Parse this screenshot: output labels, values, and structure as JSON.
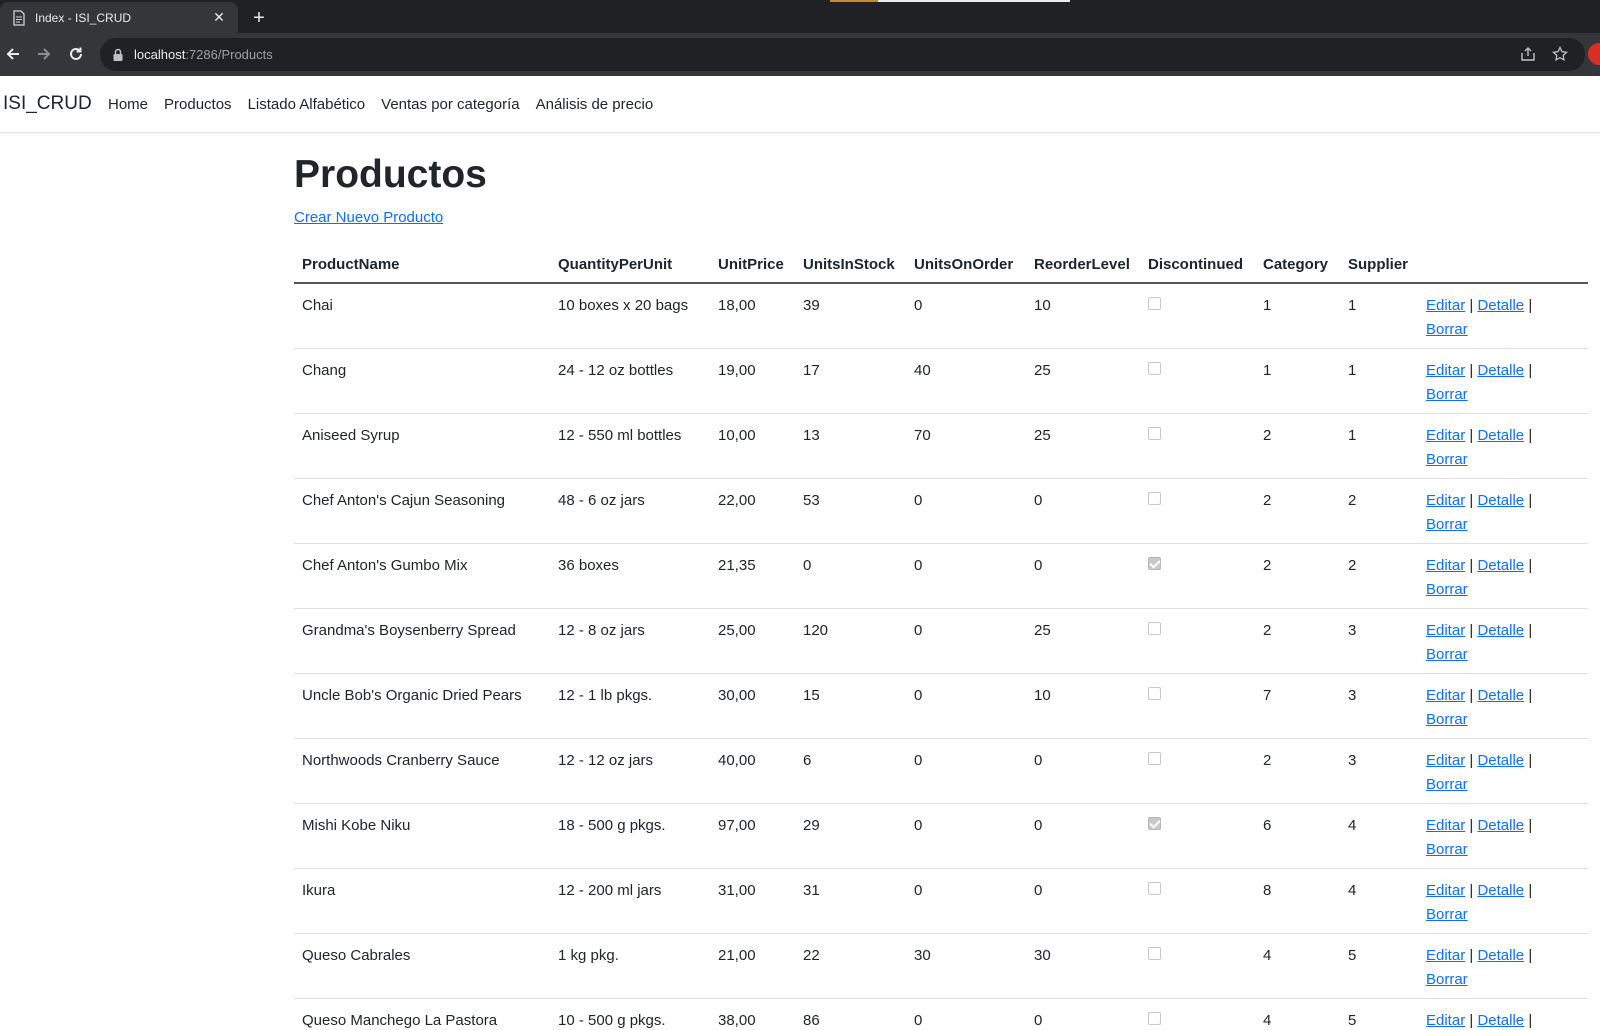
{
  "browser": {
    "tab_title": "Index - ISI_CRUD",
    "url_host": "localhost",
    "url_path": ":7286/Products"
  },
  "navbar": {
    "brand": "ISI_CRUD",
    "links": [
      "Home",
      "Productos",
      "Listado Alfabético",
      "Ventas por categoría",
      "Análisis de precio"
    ]
  },
  "page": {
    "title": "Productos",
    "create_link": "Crear Nuevo Producto"
  },
  "table": {
    "headers": [
      "ProductName",
      "QuantityPerUnit",
      "UnitPrice",
      "UnitsInStock",
      "UnitsOnOrder",
      "ReorderLevel",
      "Discontinued",
      "Category",
      "Supplier",
      ""
    ],
    "action_labels": {
      "edit": "Editar",
      "detail": "Detalle",
      "delete": "Borrar",
      "separator": "|"
    },
    "rows": [
      {
        "name": "Chai",
        "qty": "10 boxes x 20 bags",
        "price": "18,00",
        "stock": "39",
        "order": "0",
        "reorder": "10",
        "discontinued": false,
        "category": "1",
        "supplier": "1"
      },
      {
        "name": "Chang",
        "qty": "24 - 12 oz bottles",
        "price": "19,00",
        "stock": "17",
        "order": "40",
        "reorder": "25",
        "discontinued": false,
        "category": "1",
        "supplier": "1"
      },
      {
        "name": "Aniseed Syrup",
        "qty": "12 - 550 ml bottles",
        "price": "10,00",
        "stock": "13",
        "order": "70",
        "reorder": "25",
        "discontinued": false,
        "category": "2",
        "supplier": "1"
      },
      {
        "name": "Chef Anton's Cajun Seasoning",
        "qty": "48 - 6 oz jars",
        "price": "22,00",
        "stock": "53",
        "order": "0",
        "reorder": "0",
        "discontinued": false,
        "category": "2",
        "supplier": "2"
      },
      {
        "name": "Chef Anton's Gumbo Mix",
        "qty": "36 boxes",
        "price": "21,35",
        "stock": "0",
        "order": "0",
        "reorder": "0",
        "discontinued": true,
        "category": "2",
        "supplier": "2"
      },
      {
        "name": "Grandma's Boysenberry Spread",
        "qty": "12 - 8 oz jars",
        "price": "25,00",
        "stock": "120",
        "order": "0",
        "reorder": "25",
        "discontinued": false,
        "category": "2",
        "supplier": "3"
      },
      {
        "name": "Uncle Bob's Organic Dried Pears",
        "qty": "12 - 1 lb pkgs.",
        "price": "30,00",
        "stock": "15",
        "order": "0",
        "reorder": "10",
        "discontinued": false,
        "category": "7",
        "supplier": "3"
      },
      {
        "name": "Northwoods Cranberry Sauce",
        "qty": "12 - 12 oz jars",
        "price": "40,00",
        "stock": "6",
        "order": "0",
        "reorder": "0",
        "discontinued": false,
        "category": "2",
        "supplier": "3"
      },
      {
        "name": "Mishi Kobe Niku",
        "qty": "18 - 500 g pkgs.",
        "price": "97,00",
        "stock": "29",
        "order": "0",
        "reorder": "0",
        "discontinued": true,
        "category": "6",
        "supplier": "4"
      },
      {
        "name": "Ikura",
        "qty": "12 - 200 ml jars",
        "price": "31,00",
        "stock": "31",
        "order": "0",
        "reorder": "0",
        "discontinued": false,
        "category": "8",
        "supplier": "4"
      },
      {
        "name": "Queso Cabrales",
        "qty": "1 kg pkg.",
        "price": "21,00",
        "stock": "22",
        "order": "30",
        "reorder": "30",
        "discontinued": false,
        "category": "4",
        "supplier": "5"
      },
      {
        "name": "Queso Manchego La Pastora",
        "qty": "10 - 500 g pkgs.",
        "price": "38,00",
        "stock": "86",
        "order": "0",
        "reorder": "0",
        "discontinued": false,
        "category": "4",
        "supplier": "5"
      }
    ]
  },
  "colors": {
    "link": "#0d6efd",
    "chrome_dark": "#202124",
    "chrome_toolbar": "#35363a"
  }
}
